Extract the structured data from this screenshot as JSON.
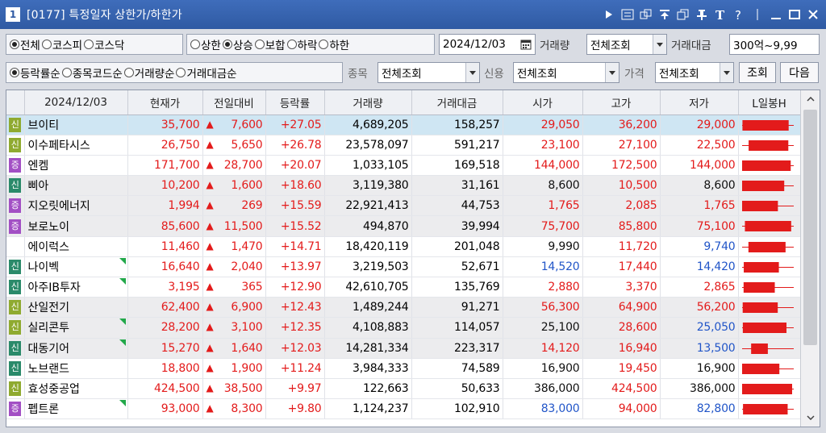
{
  "title": {
    "number": "1",
    "text": "[0177] 특정일자 상한가/하한가"
  },
  "row1": {
    "market_radios": [
      {
        "label": "전체",
        "selected": true
      },
      {
        "label": "코스피",
        "selected": false
      },
      {
        "label": "코스닥",
        "selected": false
      }
    ],
    "type_radios": [
      {
        "label": "상한",
        "selected": false
      },
      {
        "label": "상승",
        "selected": true
      },
      {
        "label": "보합",
        "selected": false
      },
      {
        "label": "하락",
        "selected": false
      },
      {
        "label": "하한",
        "selected": false
      }
    ],
    "date_value": "2024/12/03",
    "volume_label": "거래량",
    "volume_value": "전체조회",
    "amount_label": "거래대금",
    "amount_value": "300억~9,99"
  },
  "row2": {
    "sort_radios": [
      {
        "label": "등락률순",
        "selected": true
      },
      {
        "label": "종목코드순",
        "selected": false
      },
      {
        "label": "거래량순",
        "selected": false
      },
      {
        "label": "거래대금순",
        "selected": false
      }
    ],
    "stock_label": "종목",
    "stock_value": "전체조회",
    "credit_label": "신용",
    "credit_value": "전체조회",
    "price_label": "가격",
    "price_value": "전체조회",
    "search_button": "조회",
    "next_button": "다음"
  },
  "colors": {
    "up": "#e31b1b",
    "down": "#2155c8",
    "badge_sin_green": "#2a8a6a",
    "badge_sin_olive": "#8faa30",
    "badge_jeung": "#a24fc4"
  },
  "table": {
    "headers": [
      "2024/12/03",
      "현재가",
      "전일대비",
      "등락률",
      "거래량",
      "거래대금",
      "시가",
      "고가",
      "저가",
      "L일봉H"
    ],
    "rows": [
      {
        "badge": "신",
        "badge_color": "#8faa30",
        "name": "브이티",
        "flag": false,
        "price": "35,700",
        "change": "7,600",
        "rate": "+27.05",
        "volume": "4,689,205",
        "amount": "158,257",
        "open": "29,050",
        "open_c": "red",
        "high": "36,200",
        "high_c": "red",
        "low": "29,000",
        "low_c": "red",
        "candle": {
          "lo": 29000,
          "hi": 36200,
          "o": 29050,
          "c": 35700
        }
      },
      {
        "badge": "신",
        "badge_color": "#8faa30",
        "name": "이수페타시스",
        "flag": false,
        "price": "26,750",
        "change": "5,650",
        "rate": "+26.78",
        "volume": "23,578,097",
        "amount": "591,217",
        "open": "23,100",
        "open_c": "red",
        "high": "27,100",
        "high_c": "red",
        "low": "22,500",
        "low_c": "red",
        "candle": {
          "lo": 22500,
          "hi": 27100,
          "o": 23100,
          "c": 26750
        }
      },
      {
        "badge": "증",
        "badge_color": "#a24fc4",
        "name": "엔켐",
        "flag": false,
        "price": "171,700",
        "change": "28,700",
        "rate": "+20.07",
        "volume": "1,033,105",
        "amount": "169,518",
        "open": "144,000",
        "open_c": "red",
        "high": "172,500",
        "high_c": "red",
        "low": "144,000",
        "low_c": "red",
        "candle": {
          "lo": 144000,
          "hi": 172500,
          "o": 144000,
          "c": 171700
        }
      },
      {
        "badge": "신",
        "badge_color": "#2a8a6a",
        "name": "삐아",
        "flag": false,
        "price": "10,200",
        "change": "1,600",
        "rate": "+18.60",
        "volume": "3,119,380",
        "amount": "31,161",
        "open": "8,600",
        "open_c": "blk",
        "high": "10,500",
        "high_c": "red",
        "low": "8,600",
        "low_c": "blk",
        "candle": {
          "lo": 8600,
          "hi": 10500,
          "o": 8600,
          "c": 10200
        }
      },
      {
        "badge": "증",
        "badge_color": "#a24fc4",
        "name": "지오릿에너지",
        "flag": false,
        "price": "1,994",
        "change": "269",
        "rate": "+15.59",
        "volume": "22,921,413",
        "amount": "44,753",
        "open": "1,765",
        "open_c": "red",
        "high": "2,085",
        "high_c": "red",
        "low": "1,765",
        "low_c": "red",
        "candle": {
          "lo": 1765,
          "hi": 2085,
          "o": 1765,
          "c": 1994
        }
      },
      {
        "badge": "증",
        "badge_color": "#a24fc4",
        "name": "보로노이",
        "flag": false,
        "price": "85,600",
        "change": "11,500",
        "rate": "+15.52",
        "volume": "494,870",
        "amount": "39,994",
        "open": "75,700",
        "open_c": "red",
        "high": "85,800",
        "high_c": "red",
        "low": "75,100",
        "low_c": "red",
        "candle": {
          "lo": 75100,
          "hi": 85800,
          "o": 75700,
          "c": 85600
        }
      },
      {
        "badge": "",
        "badge_color": "",
        "name": "에이럭스",
        "flag": false,
        "price": "11,460",
        "change": "1,470",
        "rate": "+14.71",
        "volume": "18,420,119",
        "amount": "201,048",
        "open": "9,990",
        "open_c": "blk",
        "high": "11,720",
        "high_c": "red",
        "low": "9,740",
        "low_c": "blue",
        "candle": {
          "lo": 9740,
          "hi": 11720,
          "o": 9990,
          "c": 11460
        }
      },
      {
        "badge": "신",
        "badge_color": "#2a8a6a",
        "name": "나이벡",
        "flag": true,
        "price": "16,640",
        "change": "2,040",
        "rate": "+13.97",
        "volume": "3,219,503",
        "amount": "52,671",
        "open": "14,520",
        "open_c": "blue",
        "high": "17,440",
        "high_c": "red",
        "low": "14,420",
        "low_c": "blue",
        "candle": {
          "lo": 14420,
          "hi": 17440,
          "o": 14520,
          "c": 16640
        }
      },
      {
        "badge": "신",
        "badge_color": "#2a8a6a",
        "name": "아주IB투자",
        "flag": true,
        "price": "3,195",
        "change": "365",
        "rate": "+12.90",
        "volume": "42,610,705",
        "amount": "135,769",
        "open": "2,880",
        "open_c": "red",
        "high": "3,370",
        "high_c": "red",
        "low": "2,865",
        "low_c": "red",
        "candle": {
          "lo": 2865,
          "hi": 3370,
          "o": 2880,
          "c": 3195
        }
      },
      {
        "badge": "신",
        "badge_color": "#8faa30",
        "name": "산일전기",
        "flag": false,
        "price": "62,400",
        "change": "6,900",
        "rate": "+12.43",
        "volume": "1,489,244",
        "amount": "91,271",
        "open": "56,300",
        "open_c": "red",
        "high": "64,900",
        "high_c": "red",
        "low": "56,200",
        "low_c": "red",
        "candle": {
          "lo": 56200,
          "hi": 64900,
          "o": 56300,
          "c": 62400
        }
      },
      {
        "badge": "신",
        "badge_color": "#8faa30",
        "name": "실리콘투",
        "flag": true,
        "price": "28,200",
        "change": "3,100",
        "rate": "+12.35",
        "volume": "4,108,883",
        "amount": "114,057",
        "open": "25,100",
        "open_c": "blk",
        "high": "28,600",
        "high_c": "red",
        "low": "25,050",
        "low_c": "blue",
        "candle": {
          "lo": 25050,
          "hi": 28600,
          "o": 25100,
          "c": 28200
        }
      },
      {
        "badge": "신",
        "badge_color": "#2a8a6a",
        "name": "대동기어",
        "flag": true,
        "price": "15,270",
        "change": "1,640",
        "rate": "+12.03",
        "volume": "14,281,334",
        "amount": "223,317",
        "open": "14,120",
        "open_c": "red",
        "high": "16,940",
        "high_c": "red",
        "low": "13,500",
        "low_c": "blue",
        "candle": {
          "lo": 13500,
          "hi": 16940,
          "o": 14120,
          "c": 15270
        }
      },
      {
        "badge": "신",
        "badge_color": "#2a8a6a",
        "name": "노브랜드",
        "flag": false,
        "price": "18,800",
        "change": "1,900",
        "rate": "+11.24",
        "volume": "3,984,333",
        "amount": "74,589",
        "open": "16,900",
        "open_c": "blk",
        "high": "19,450",
        "high_c": "red",
        "low": "16,900",
        "low_c": "blk",
        "candle": {
          "lo": 16900,
          "hi": 19450,
          "o": 16900,
          "c": 18800
        }
      },
      {
        "badge": "신",
        "badge_color": "#8faa30",
        "name": "효성중공업",
        "flag": false,
        "price": "424,500",
        "change": "38,500",
        "rate": "+9.97",
        "volume": "122,663",
        "amount": "50,633",
        "open": "386,000",
        "open_c": "blk",
        "high": "424,500",
        "high_c": "red",
        "low": "386,000",
        "low_c": "blk",
        "candle": {
          "lo": 386000,
          "hi": 424500,
          "o": 386000,
          "c": 424500
        }
      },
      {
        "badge": "증",
        "badge_color": "#a24fc4",
        "name": "펩트론",
        "flag": true,
        "price": "93,000",
        "change": "8,300",
        "rate": "+9.80",
        "volume": "1,124,237",
        "amount": "102,910",
        "open": "83,000",
        "open_c": "blue",
        "high": "94,000",
        "high_c": "red",
        "low": "82,800",
        "low_c": "blue",
        "candle": {
          "lo": 82800,
          "hi": 94000,
          "o": 83000,
          "c": 93000
        }
      }
    ]
  }
}
